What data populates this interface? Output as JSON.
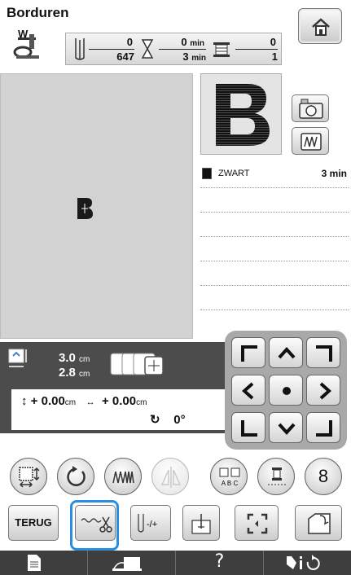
{
  "header": {
    "title": "Borduren",
    "presser_foot_letter": "W",
    "stitches_done": "0",
    "stitches_total": "647",
    "time_done": "0",
    "time_done_unit": "min",
    "time_total": "3",
    "time_total_unit": "min",
    "color_done": "0",
    "color_total": "1"
  },
  "thread_list": [
    {
      "color": "#111111",
      "name": "ZWART",
      "time": "3 min"
    }
  ],
  "edit": {
    "width": "3.0",
    "height": "2.8",
    "unit": "cm",
    "shift_v": "+ 0.00",
    "shift_h": "+ 0.00",
    "rotation": "0°"
  },
  "buttons": {
    "back_label": "TERUG",
    "help_label": "?",
    "rotate_step_label": "8"
  },
  "colors": {
    "highlight": "#2a8fe0",
    "band_bg": "#4c4c4c",
    "preview_bg": "#d2d2d2"
  }
}
